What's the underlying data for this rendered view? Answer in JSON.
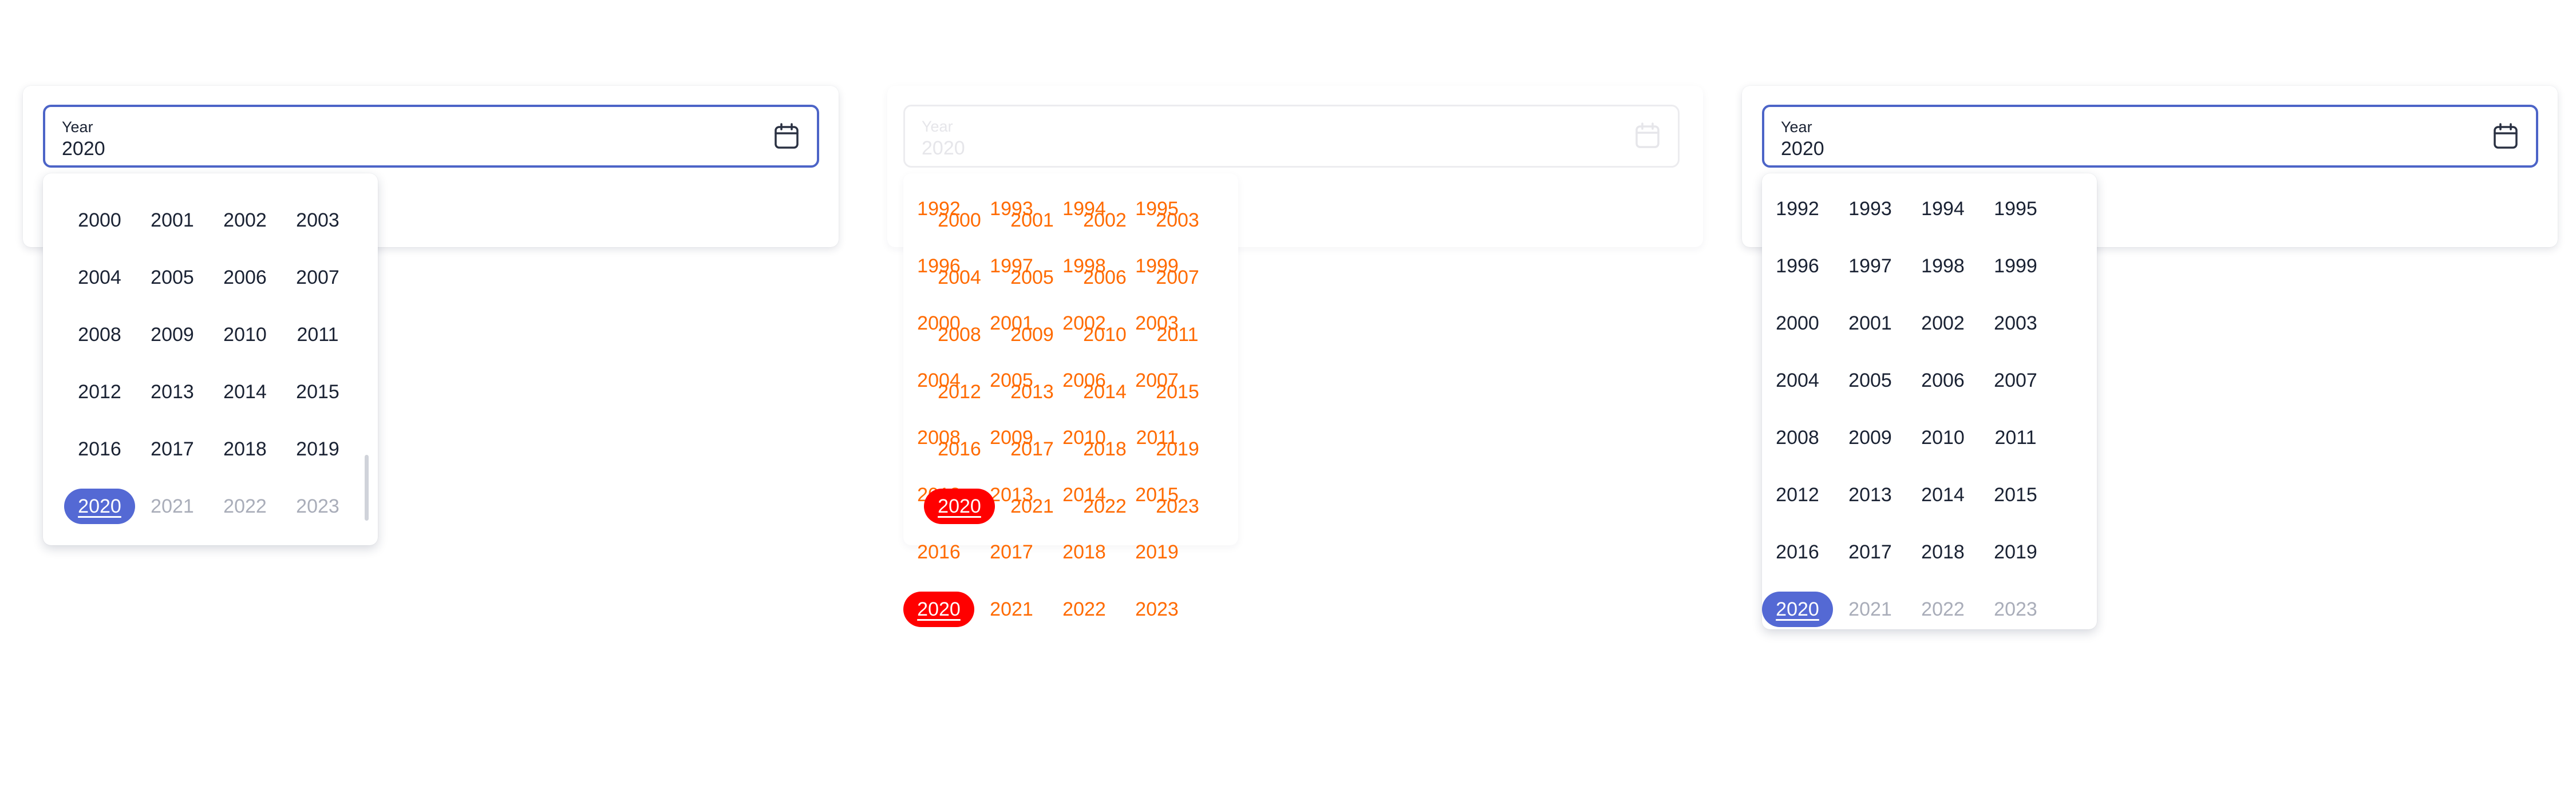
{
  "pickers": [
    {
      "id": "left",
      "field": {
        "label": "Year",
        "value": "2020"
      }
    },
    {
      "id": "middle",
      "field": {
        "label": "Year",
        "value": "2020"
      }
    },
    {
      "id": "right",
      "field": {
        "label": "Year",
        "value": "2020"
      }
    }
  ],
  "years_left": [
    "2000",
    "2001",
    "2002",
    "2003",
    "2004",
    "2005",
    "2006",
    "2007",
    "2008",
    "2009",
    "2010",
    "2011",
    "2012",
    "2013",
    "2014",
    "2015",
    "2016",
    "2017",
    "2018",
    "2019",
    "2020",
    "2021",
    "2022",
    "2023"
  ],
  "years_right": [
    "1992",
    "1993",
    "1994",
    "1995",
    "1996",
    "1997",
    "1998",
    "1999",
    "2000",
    "2001",
    "2002",
    "2003",
    "2004",
    "2005",
    "2006",
    "2007",
    "2008",
    "2009",
    "2010",
    "2011",
    "2012",
    "2013",
    "2014",
    "2015",
    "2016",
    "2017",
    "2018",
    "2019",
    "2020",
    "2021",
    "2022",
    "2023"
  ],
  "selected_year": "2020",
  "icon": "calendar-icon",
  "colors": {
    "accent": "#4c64c7",
    "selected_fill": "#5469d4",
    "broken_text": "#ff6a00",
    "broken_selected": "#ff0000",
    "future_year": "#a9adb9"
  }
}
